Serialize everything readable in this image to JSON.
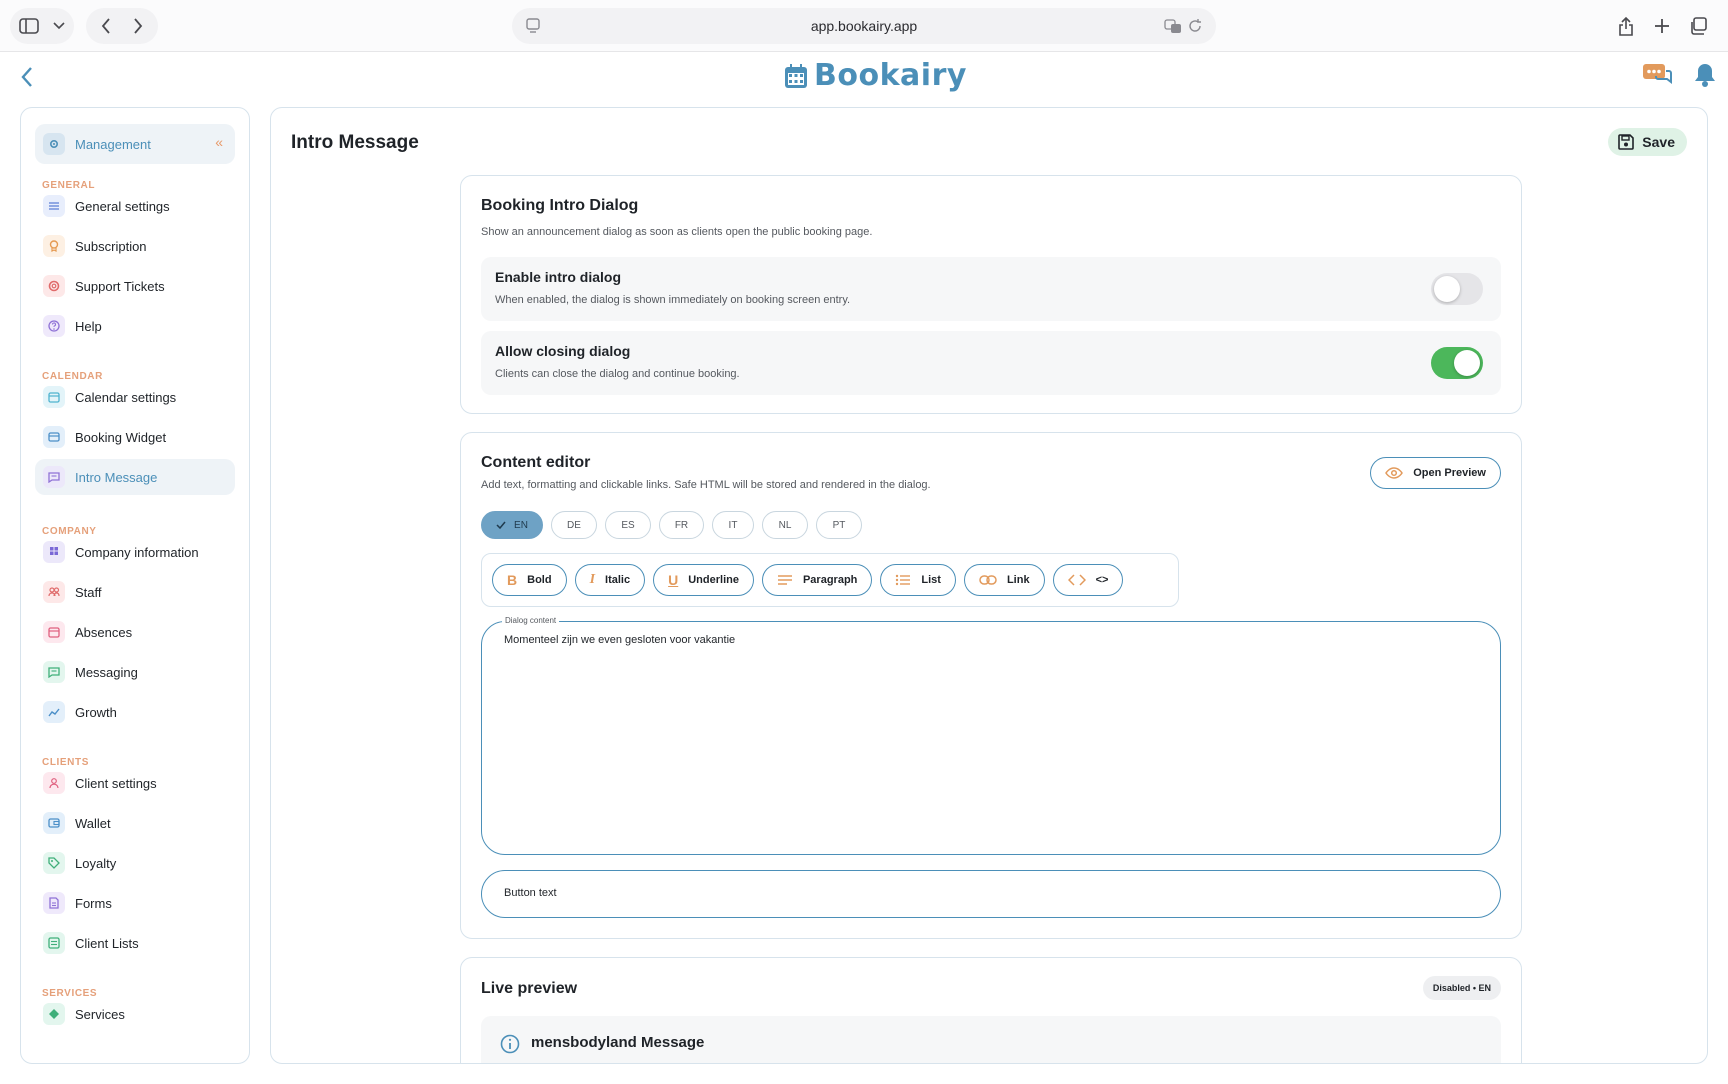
{
  "browser": {
    "url": "app.bookairy.app"
  },
  "app": {
    "brand": "Bookairy"
  },
  "sidebar": {
    "header_label": "Management",
    "sections": {
      "general": "GENERAL",
      "calendar": "CALENDAR",
      "company": "COMPANY",
      "clients": "CLIENTS",
      "services": "SERVICES"
    },
    "items": [
      {
        "label": "General settings",
        "icon": "sliders-icon",
        "color": "#e8eefc",
        "fg": "#6b8ad9"
      },
      {
        "label": "Subscription",
        "icon": "badge-icon",
        "color": "#fdf0e3",
        "fg": "#e59a52"
      },
      {
        "label": "Support Tickets",
        "icon": "lifebuoy-icon",
        "color": "#fde8e8",
        "fg": "#e06b6b"
      },
      {
        "label": "Help",
        "icon": "help-icon",
        "color": "#efe9fb",
        "fg": "#8f72d6"
      },
      {
        "label": "Calendar settings",
        "icon": "calendar-icon",
        "color": "#e3f4f9",
        "fg": "#4fb3cf"
      },
      {
        "label": "Booking Widget",
        "icon": "widget-icon",
        "color": "#e3effa",
        "fg": "#4b8fc8"
      },
      {
        "label": "Intro Message",
        "icon": "message-icon",
        "color": "#ece8fa",
        "fg": "#8f72d6"
      },
      {
        "label": "Company information",
        "icon": "building-icon",
        "color": "#ece8fa",
        "fg": "#7a68d6"
      },
      {
        "label": "Staff",
        "icon": "people-icon",
        "color": "#fde8e8",
        "fg": "#e06b6b"
      },
      {
        "label": "Absences",
        "icon": "calendar-x-icon",
        "color": "#fde8ee",
        "fg": "#e0607f"
      },
      {
        "label": "Messaging",
        "icon": "chat-icon",
        "color": "#e3f6ee",
        "fg": "#3faf7a"
      },
      {
        "label": "Growth",
        "icon": "trend-icon",
        "color": "#e3effa",
        "fg": "#4b8fc8"
      },
      {
        "label": "Client settings",
        "icon": "person-icon",
        "color": "#fde8ee",
        "fg": "#e0607f"
      },
      {
        "label": "Wallet",
        "icon": "wallet-icon",
        "color": "#e3effa",
        "fg": "#4b8fc8"
      },
      {
        "label": "Loyalty",
        "icon": "tag-icon",
        "color": "#e3f6ee",
        "fg": "#3faf7a"
      },
      {
        "label": "Forms",
        "icon": "form-icon",
        "color": "#efe9fb",
        "fg": "#8f72d6"
      },
      {
        "label": "Client Lists",
        "icon": "list-icon",
        "color": "#e3f6ee",
        "fg": "#3faf7a"
      },
      {
        "label": "Services",
        "icon": "gem-icon",
        "color": "#e3f6ee",
        "fg": "#3faf7a"
      }
    ]
  },
  "main": {
    "title": "Intro Message",
    "save_label": "Save",
    "booking_dialog": {
      "title": "Booking Intro Dialog",
      "description": "Show an announcement dialog as soon as clients open the public booking page.",
      "enable": {
        "title": "Enable intro dialog",
        "description": "When enabled, the dialog is shown immediately on booking screen entry.",
        "on": false
      },
      "allow_close": {
        "title": "Allow closing dialog",
        "description": "Clients can close the dialog and continue booking.",
        "on": true
      }
    },
    "content_editor": {
      "title": "Content editor",
      "description": "Add text, formatting and clickable links. Safe HTML will be stored and rendered in the dialog.",
      "preview_button": "Open Preview",
      "languages": [
        "EN",
        "DE",
        "ES",
        "FR",
        "IT",
        "NL",
        "PT"
      ],
      "selected_language": "EN",
      "toolbar": {
        "bold": "Bold",
        "italic": "Italic",
        "underline": "Underline",
        "paragraph": "Paragraph",
        "list": "List",
        "link": "Link",
        "code": "<>"
      },
      "dialog_content_label": "Dialog content",
      "dialog_content_value": "Momenteel zijn we even gesloten voor vakantie",
      "button_text_placeholder": "Button text"
    },
    "live_preview": {
      "title": "Live preview",
      "badge": "Disabled • EN",
      "message_title": "mensbodyland Message"
    }
  },
  "colors": {
    "brand": "#4b8fb8",
    "accent_orange": "#e5a07a",
    "toggle_on": "#4cb75b",
    "toggle_off": "#e5e5e8"
  }
}
